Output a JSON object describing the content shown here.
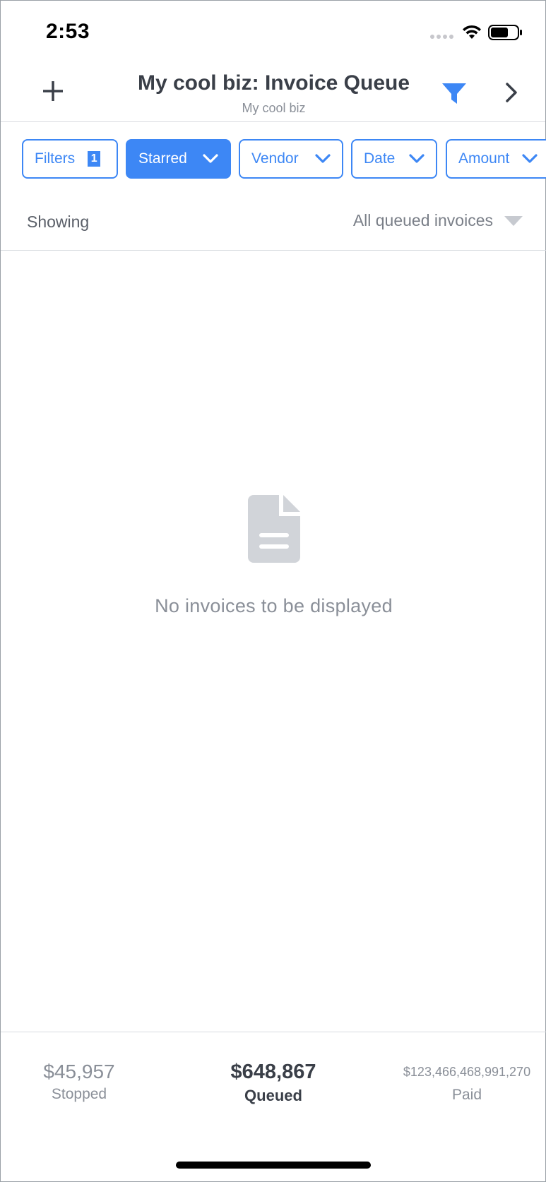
{
  "status_bar": {
    "time": "2:53"
  },
  "header": {
    "title": "My cool biz: Invoice Queue",
    "subtitle": "My cool biz",
    "add_icon": "plus-icon",
    "filter_icon": "funnel-icon",
    "next_icon": "chevron-right-icon"
  },
  "chips": [
    {
      "label": "Filters",
      "badge": "1",
      "active": false
    },
    {
      "label": "Starred",
      "active": true
    },
    {
      "label": "Vendor",
      "active": false
    },
    {
      "label": "Date",
      "active": false
    },
    {
      "label": "Amount",
      "active": false
    }
  ],
  "showing": {
    "label": "Showing",
    "value": "All queued invoices"
  },
  "empty_state": {
    "icon": "document-icon",
    "message": "No invoices to be displayed"
  },
  "totals": {
    "stopped": {
      "amount": "$45,957",
      "label": "Stopped"
    },
    "queued": {
      "amount": "$648,867",
      "label": "Queued"
    },
    "paid": {
      "amount": "$123,466,468,991,270",
      "label": "Paid"
    }
  },
  "colors": {
    "accent": "#3d87f5",
    "text_dark": "#3a3f48",
    "text_muted": "#8a8f98",
    "divider": "#d8dbe0",
    "icon_gray": "#d1d4d9"
  }
}
